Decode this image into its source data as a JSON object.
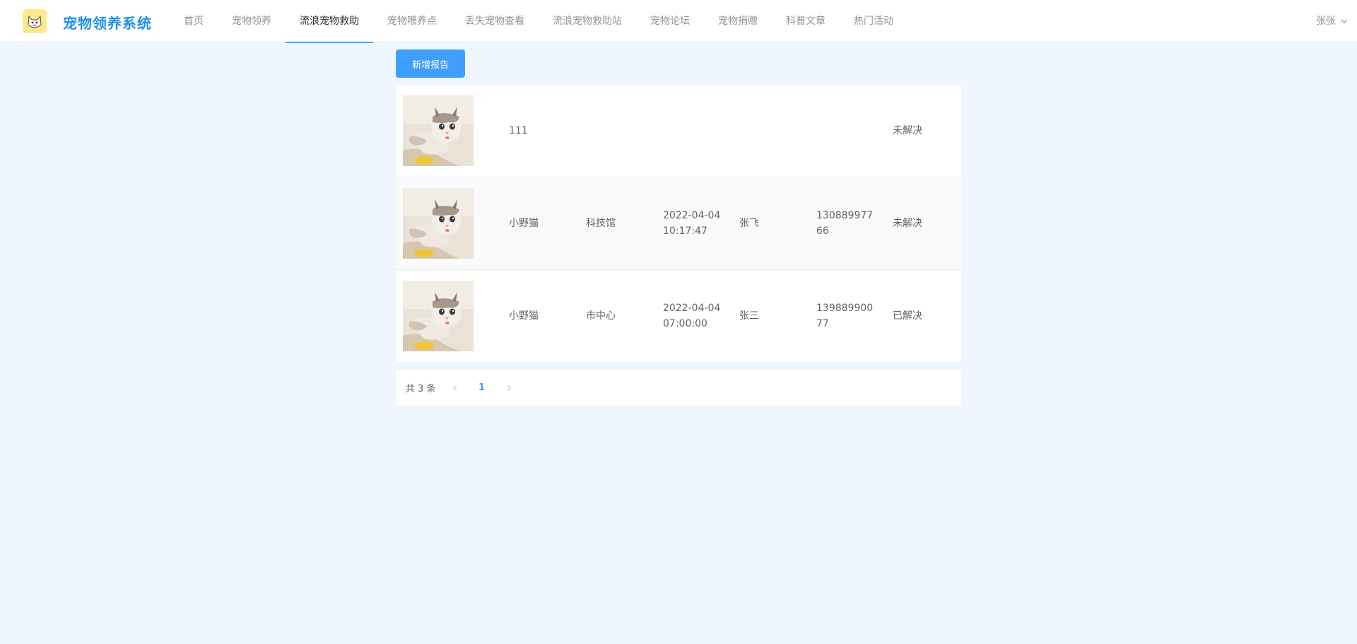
{
  "app": {
    "brand": "宠物领养系统",
    "logo_icon": "pet-logo-icon",
    "accent_color": "#409eff",
    "brand_color": "#1f8ff0"
  },
  "nav": {
    "items": [
      {
        "label": "首页",
        "active": false
      },
      {
        "label": "宠物领养",
        "active": false
      },
      {
        "label": "流浪宠物救助",
        "active": true
      },
      {
        "label": "宠物喂养点",
        "active": false
      },
      {
        "label": "丢失宠物查看",
        "active": false
      },
      {
        "label": "流浪宠物救助站",
        "active": false
      },
      {
        "label": "宠物论坛",
        "active": false
      },
      {
        "label": "宠物捐赠",
        "active": false
      },
      {
        "label": "科普文章",
        "active": false
      },
      {
        "label": "热门活动",
        "active": false
      }
    ]
  },
  "user": {
    "name": "张张",
    "dropdown_icon": "chevron-down-icon"
  },
  "toolbar": {
    "add_label": "新增报告"
  },
  "reports": [
    {
      "image": "cat-photo",
      "name": "111",
      "location": "",
      "time": "",
      "reporter": "",
      "phone": "",
      "status": "未解决"
    },
    {
      "image": "cat-photo",
      "name": "小野猫",
      "location": "科技馆",
      "time": "2022-04-04 10:17:47",
      "reporter": "张飞",
      "phone": "13088997766",
      "status": "未解决"
    },
    {
      "image": "cat-photo",
      "name": "小野猫",
      "location": "市中心",
      "time": "2022-04-04 07:00:00",
      "reporter": "张三",
      "phone": "13988990077",
      "status": "已解决"
    }
  ],
  "pagination": {
    "total_text": "共 3 条",
    "current_page": "1",
    "prev_icon": "chevron-left-icon",
    "next_icon": "chevron-right-icon"
  }
}
